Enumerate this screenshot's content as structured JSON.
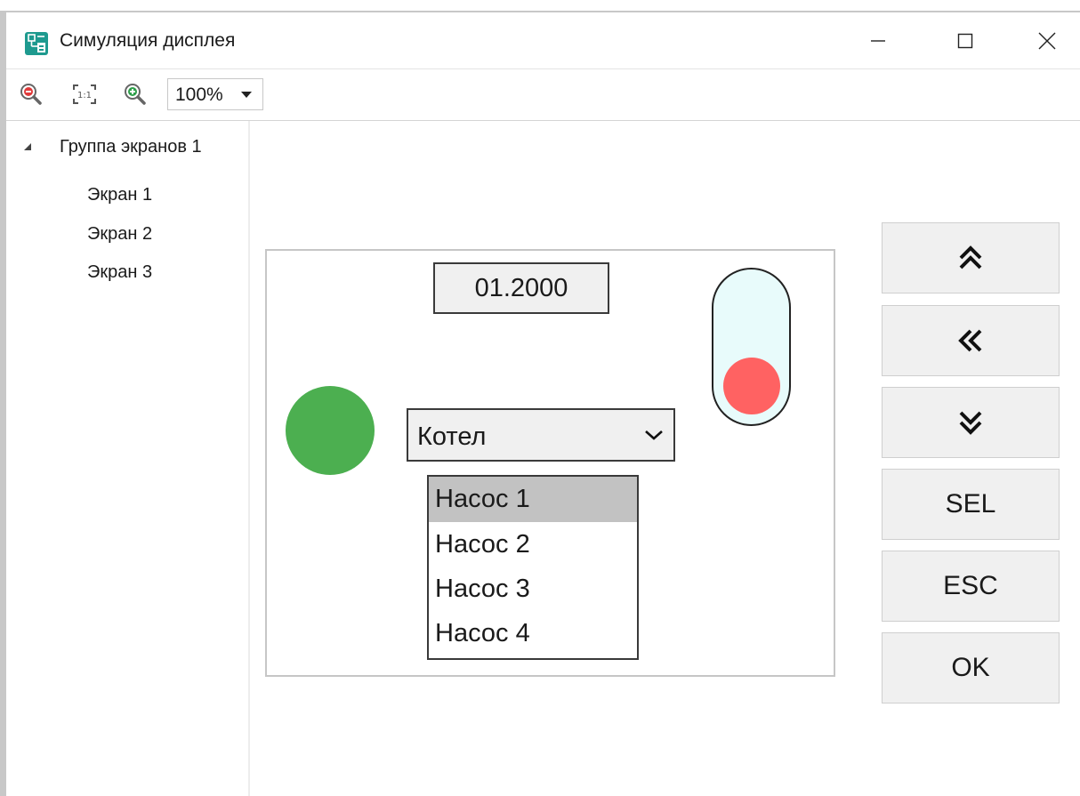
{
  "window": {
    "title": "Симуляция дисплея",
    "app_icon": "display-simulation-icon",
    "accent": "#1e9a8f"
  },
  "toolbar": {
    "zoom_out_icon": "zoom-out-icon",
    "actual_size_icon": "actual-size-icon",
    "zoom_in_icon": "zoom-in-icon",
    "zoom_value": "100%"
  },
  "tree": {
    "group_label": "Группа экранов 1",
    "items": [
      {
        "label": "Экран 1"
      },
      {
        "label": "Экран 2"
      },
      {
        "label": "Экран 3"
      }
    ]
  },
  "display": {
    "date_value": "01.2000",
    "indicator_color": "#4caf50",
    "combo_value": "Котел",
    "list": {
      "items": [
        {
          "label": "Насос 1",
          "selected": true
        },
        {
          "label": "Насос 2",
          "selected": false
        },
        {
          "label": "Насос 3",
          "selected": false
        },
        {
          "label": "Насос 4",
          "selected": false
        }
      ]
    },
    "toggle": {
      "state": "off",
      "knob_color": "#ff6262"
    }
  },
  "keypad": {
    "page_up_icon": "double-chevron-up-icon",
    "back_icon": "double-chevron-left-icon",
    "page_down_icon": "double-chevron-down-icon",
    "sel": "SEL",
    "esc": "ESC",
    "ok": "OK"
  }
}
